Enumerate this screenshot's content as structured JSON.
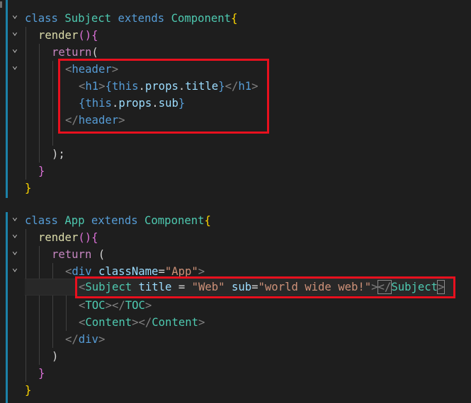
{
  "code": {
    "l1": {
      "kw": "class",
      "name": "Subject",
      "ext": "extends",
      "base": "Component",
      "brace": "{"
    },
    "l2": {
      "fn": "render",
      "paren": "()",
      "brace": "{"
    },
    "l3": {
      "kw": "return",
      "paren": "("
    },
    "l4": {
      "open": "<",
      "tag": "header",
      "close": ">"
    },
    "l5": {
      "open": "<",
      "tag": "h1",
      "close": ">",
      "brace_open": "{",
      "this": "this",
      "dot": ".",
      "props": "props",
      "dot2": ".",
      "prop": "title",
      "brace_close": "}",
      "end_open": "</",
      "end_tag": "h1",
      "end_close": ">"
    },
    "l6": {
      "brace_open": "{",
      "this": "this",
      "dot": ".",
      "props": "props",
      "dot2": ".",
      "prop": "sub",
      "brace_close": "}"
    },
    "l7": {
      "open": "</",
      "tag": "header",
      "close": ">"
    },
    "l9": {
      "text": ");"
    },
    "l10": {
      "text": "}"
    },
    "l11": {
      "text": "}"
    },
    "l13": {
      "kw": "class",
      "name": "App",
      "ext": "extends",
      "base": "Component",
      "brace": "{"
    },
    "l14": {
      "fn": "render",
      "paren": "()",
      "brace": "{"
    },
    "l15": {
      "kw": "return",
      "paren": "("
    },
    "l16": {
      "open": "<",
      "tag": "div",
      "attr": "className",
      "eq": "=",
      "val": "\"App\"",
      "close": ">"
    },
    "l17": {
      "open": "<",
      "tag": "Subject",
      "attr1": "title",
      "eq1": " = ",
      "val1": "\"Web\"",
      "attr2": "sub",
      "eq2": "=",
      "val2": "\"world wide web!\"",
      "close": ">",
      "end_open": "</",
      "end_tag": "Subject",
      "end_close": ">"
    },
    "l18": {
      "open": "<",
      "tag": "TOC",
      "close": "></",
      "end_tag": "TOC",
      "end_close": ">"
    },
    "l19": {
      "open": "<",
      "tag": "Content",
      "close": "></",
      "end_tag": "Content",
      "end_close": ">"
    },
    "l20": {
      "open": "</",
      "tag": "div",
      "close": ">"
    },
    "l21": {
      "text": ")"
    },
    "l22": {
      "text": "}"
    },
    "l23": {
      "text": "}"
    }
  },
  "colors": {
    "highlight_box": "#e8101e",
    "modified_bar": "#1b81a8"
  }
}
